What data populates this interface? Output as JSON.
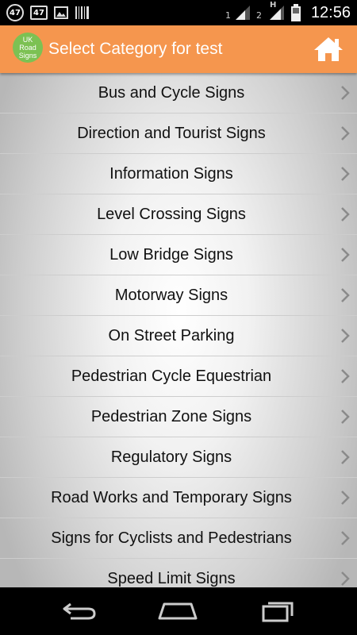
{
  "status_bar": {
    "notif_count_1": "47",
    "notif_count_2": "47",
    "sim1_label": "1",
    "sim2_label": "2",
    "network_type": "H",
    "time": "12:56"
  },
  "action_bar": {
    "logo_lines": [
      "UK",
      "Road",
      "Signs"
    ],
    "title": "Select Category for test",
    "home_icon": "home-icon"
  },
  "categories": [
    {
      "label": "Bus and Cycle Signs"
    },
    {
      "label": "Direction and Tourist Signs"
    },
    {
      "label": "Information Signs"
    },
    {
      "label": "Level Crossing Signs"
    },
    {
      "label": "Low Bridge Signs"
    },
    {
      "label": "Motorway Signs"
    },
    {
      "label": "On Street Parking"
    },
    {
      "label": "Pedestrian Cycle Equestrian"
    },
    {
      "label": "Pedestrian Zone Signs"
    },
    {
      "label": "Regulatory Signs"
    },
    {
      "label": "Road Works and Temporary Signs"
    },
    {
      "label": "Signs for Cyclists and Pedestrians"
    },
    {
      "label": "Speed Limit Signs"
    }
  ],
  "colors": {
    "action_bar": "#f5964e",
    "logo": "#7cc153",
    "list_text": "#111111"
  },
  "nav_bar": {
    "back": "back-icon",
    "home": "home-nav-icon",
    "recents": "recents-icon"
  }
}
